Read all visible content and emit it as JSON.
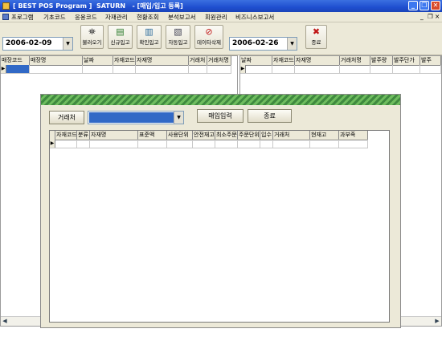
{
  "window": {
    "title": "[ BEST POS Program ]  SATURN   - [매입/입고 등록]",
    "controls": [
      "_",
      "❐",
      "✕"
    ]
  },
  "menu": {
    "items": [
      "프로그램",
      "기초코드",
      "응용코드",
      "자재관리",
      "현황조회",
      "분석보고서",
      "회원관리",
      "비즈니스보고서"
    ],
    "right_controls": [
      "_",
      "❐",
      "×"
    ]
  },
  "toolbar": {
    "date_from": "2006-02-09",
    "date_to": "2006-02-26",
    "buttons": [
      {
        "label": "불러오기",
        "icon": "binoculars-icon",
        "glyph": "⛯"
      },
      {
        "label": "신규입고",
        "icon": "new-document-icon",
        "glyph": "▤"
      },
      {
        "label": "확인입고",
        "icon": "confirm-document-icon",
        "glyph": "▥"
      },
      {
        "label": "자동입고",
        "icon": "auto-import-icon",
        "glyph": "▧"
      },
      {
        "label": "데이타삭제",
        "icon": "delete-data-icon",
        "glyph": "⊘"
      }
    ],
    "exit_label": "종료",
    "exit_glyph": "✖"
  },
  "left_grid": {
    "columns": [
      "매장코드",
      "매장명",
      "날짜",
      "자재코드",
      "자재명",
      "거래처",
      "거래처명"
    ]
  },
  "right_grid": {
    "columns": [
      "날짜",
      "자재코드",
      "자재명",
      "거래처명",
      "발주량",
      "발주단가",
      "발주"
    ]
  },
  "dialog": {
    "vendor_label": "거래처",
    "vendor_value": "",
    "import_button": "매입입력",
    "close_button": "종료",
    "columns": [
      "자재코드",
      "분류",
      "자재명",
      "표준액",
      "사용단위",
      "안전재고",
      "최소주문",
      "주문단위",
      "입수",
      "거래처",
      "현재고",
      "과부족"
    ]
  }
}
